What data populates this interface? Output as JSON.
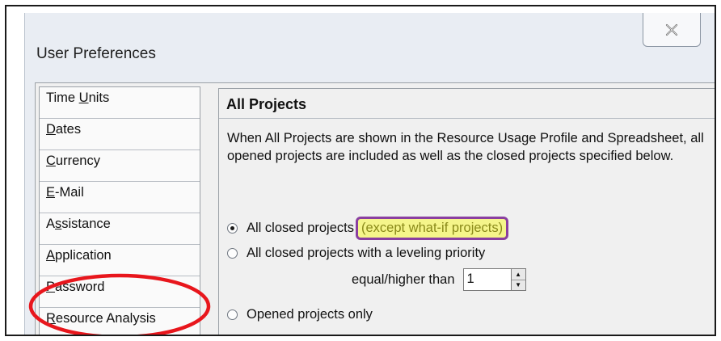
{
  "dialog": {
    "title": "User Preferences"
  },
  "nav": {
    "items": [
      {
        "pre": "Time ",
        "u": "U",
        "post": "nits"
      },
      {
        "pre": "",
        "u": "D",
        "post": "ates"
      },
      {
        "pre": "",
        "u": "C",
        "post": "urrency"
      },
      {
        "pre": "",
        "u": "E",
        "post": "-Mail"
      },
      {
        "pre": "A",
        "u": "s",
        "post": "sistance"
      },
      {
        "pre": "",
        "u": "A",
        "post": "pplication"
      },
      {
        "pre": "",
        "u": "P",
        "post": "assword"
      },
      {
        "pre": "",
        "u": "R",
        "post": "esource Analysis"
      }
    ]
  },
  "panel": {
    "header": "All Projects",
    "description": "When All Projects are shown in the Resource Usage Profile and Spreadsheet, all opened projects are included as well as the closed projects specified below.",
    "options": {
      "all_closed": "All closed projects",
      "all_closed_note": "(except what-if projects)",
      "leveling": "All closed projects with a leveling priority",
      "opened_only": "Opened projects only"
    },
    "priority_label": "equal/higher than",
    "priority_value": "1"
  },
  "colors": {
    "highlight_fill": "#f5f58a",
    "highlight_border": "#8a3fa0",
    "annotation_ellipse": "#e8161c"
  }
}
